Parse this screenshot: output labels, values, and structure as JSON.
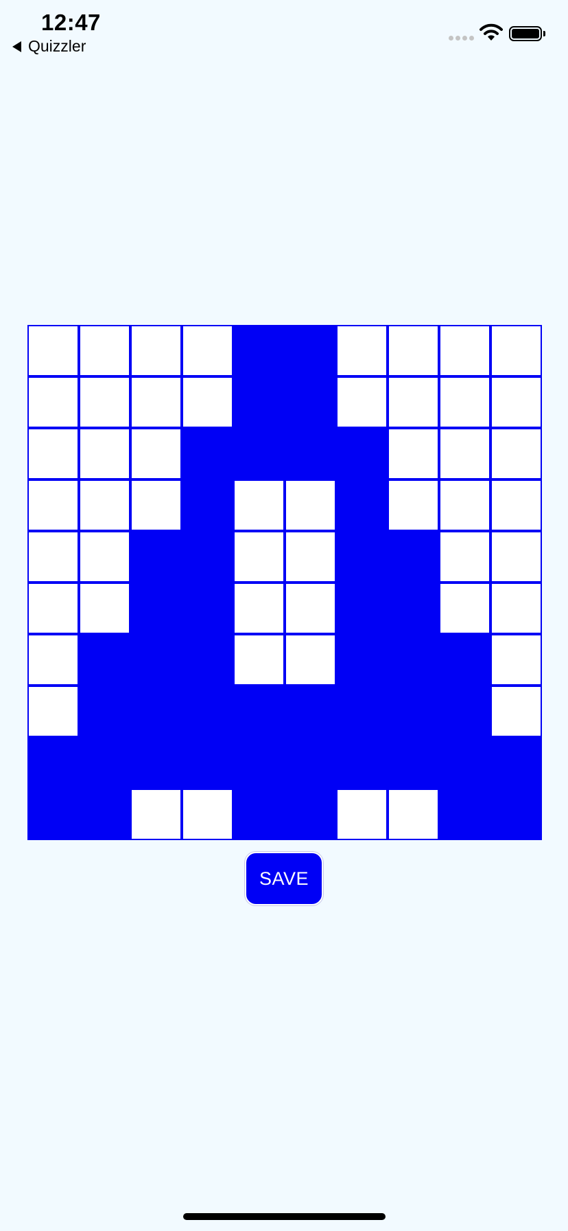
{
  "status_bar": {
    "time": "12:47",
    "back_app": "Quizzler",
    "icons": [
      "cellular-signal-icon",
      "wifi-icon",
      "battery-icon"
    ]
  },
  "colors": {
    "accent": "#0000f5",
    "cell_empty": "#ffffff",
    "background": "#f2faff"
  },
  "grid": {
    "rows": 10,
    "cols": 10,
    "cells": [
      [
        0,
        0,
        0,
        0,
        1,
        1,
        0,
        0,
        0,
        0
      ],
      [
        0,
        0,
        0,
        0,
        1,
        1,
        0,
        0,
        0,
        0
      ],
      [
        0,
        0,
        0,
        1,
        1,
        1,
        1,
        0,
        0,
        0
      ],
      [
        0,
        0,
        0,
        1,
        0,
        0,
        1,
        0,
        0,
        0
      ],
      [
        0,
        0,
        1,
        1,
        0,
        0,
        1,
        1,
        0,
        0
      ],
      [
        0,
        0,
        1,
        1,
        0,
        0,
        1,
        1,
        0,
        0
      ],
      [
        0,
        1,
        1,
        1,
        0,
        0,
        1,
        1,
        1,
        0
      ],
      [
        0,
        1,
        1,
        1,
        1,
        1,
        1,
        1,
        1,
        0
      ],
      [
        1,
        1,
        1,
        1,
        1,
        1,
        1,
        1,
        1,
        1
      ],
      [
        1,
        1,
        0,
        0,
        1,
        1,
        0,
        0,
        1,
        1
      ]
    ]
  },
  "save_button": {
    "label": "SAVE"
  }
}
